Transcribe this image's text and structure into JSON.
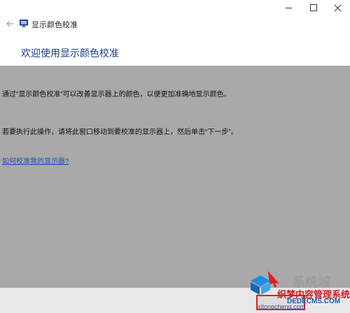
{
  "window": {
    "title": "显示颜色校准",
    "controls": {
      "minimize": "minimize-icon",
      "maximize": "maximize-icon",
      "close": "close-icon"
    }
  },
  "nav": {
    "back_icon": "arrow-left-icon",
    "app_icon": "monitor-icon"
  },
  "page": {
    "heading": "欢迎使用显示颜色校准",
    "paragraph1": "通过“显示颜色校准”可以改善显示器上的颜色，以便更加准确地显示颜色。",
    "paragraph2": "若要执行此操作，请将此窗口移动到要校准的显示器上，然后单击“下一步”。",
    "help_link": "如何校准我的显示器?"
  },
  "footer": {
    "next_label": ""
  },
  "watermark": {
    "line1": "织梦内容管理系统",
    "line2": "DEDECMS.COM",
    "line3": "xitongcheng.com",
    "big": "系统城",
    "logo": "windows-logo-icon"
  },
  "colors": {
    "accent": "#1a3e8c",
    "link": "#1d4fb5",
    "overlay": "#a9a9a9",
    "highlight": "#e02020"
  }
}
